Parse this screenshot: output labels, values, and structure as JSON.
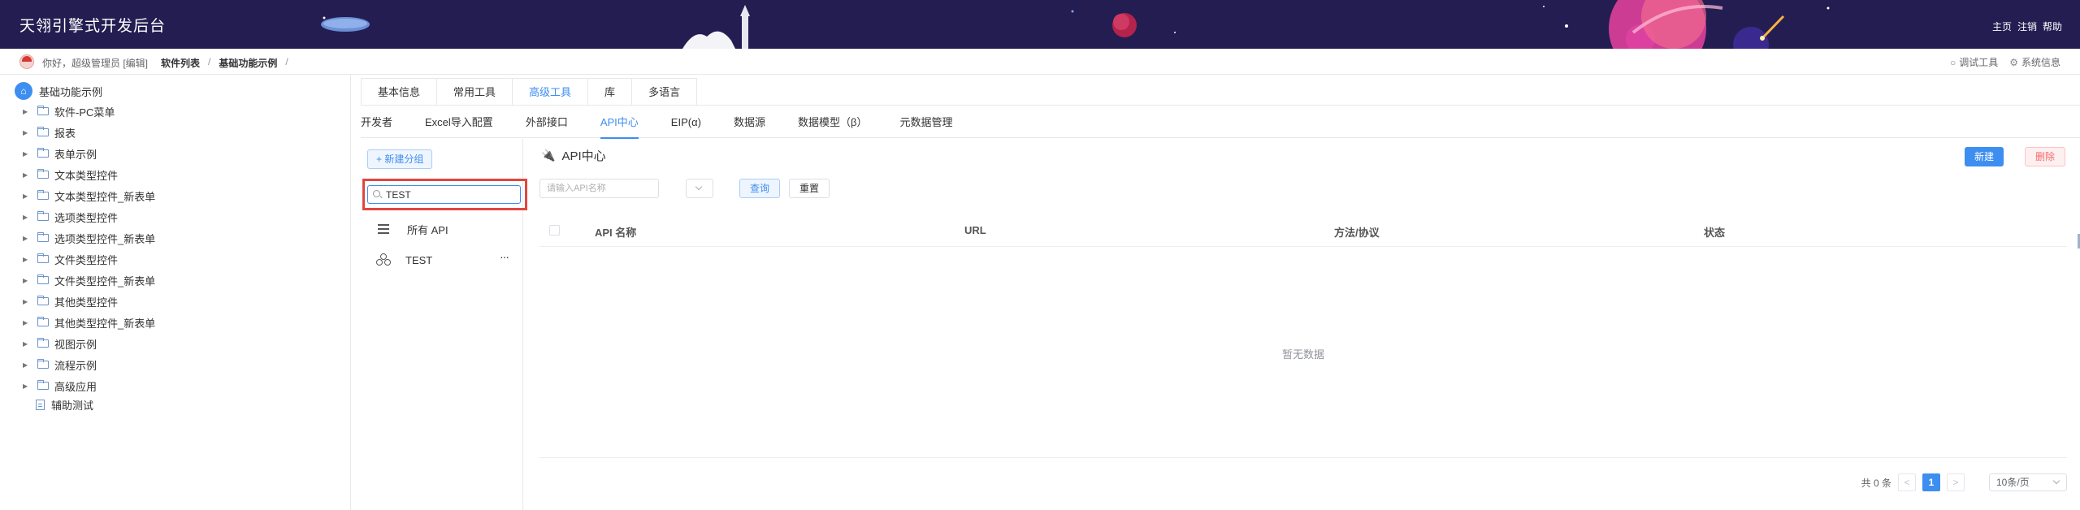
{
  "header": {
    "title": "天翎引擎式开发后台",
    "links": [
      "主页",
      "注销",
      "帮助"
    ]
  },
  "breadcrumb": {
    "greeting": "你好，超级管理员 [编辑]",
    "crumb1": "软件列表",
    "crumb2": "基础功能示例",
    "sep": "/",
    "debug_tool": "调试工具",
    "system_info": "系统信息"
  },
  "tree": {
    "root": "基础功能示例",
    "items": [
      "软件-PC菜单",
      "报表",
      "表单示例",
      "文本类型控件",
      "文本类型控件_新表单",
      "选项类型控件",
      "选项类型控件_新表单",
      "文件类型控件",
      "文件类型控件_新表单",
      "其他类型控件",
      "其他类型控件_新表单",
      "视图示例",
      "流程示例",
      "高级应用"
    ],
    "leaf": "辅助测试"
  },
  "tabs_top": [
    "基本信息",
    "常用工具",
    "高级工具",
    "库",
    "多语言"
  ],
  "tabs_sub": [
    "开发者",
    "Excel导入配置",
    "外部接口",
    "API中心",
    "EIP(α)",
    "数据源",
    "数据模型（β）",
    "元数据管理"
  ],
  "groups": {
    "new_group": "+ 新建分组",
    "search_value": "TEST",
    "all_api": "所有 API",
    "group_test": "TEST",
    "more": "···"
  },
  "api_center": {
    "title": "API中心",
    "new_button": "新建",
    "delete_button": "删除",
    "api_name_placeholder": "请输入API名称",
    "query_button": "查询",
    "reset_button": "重置",
    "columns": [
      "API 名称",
      "URL",
      "方法/协议",
      "状态"
    ],
    "empty_text": "暂无数据",
    "total": "共 0 条",
    "page": "1",
    "page_size": "10条/页",
    "prev": "<",
    "next": ">"
  },
  "colors": {
    "header_bg": "#241d52",
    "accent": "#3d8ef0",
    "highlight": "#e0473f",
    "danger": "#f56c6c"
  }
}
